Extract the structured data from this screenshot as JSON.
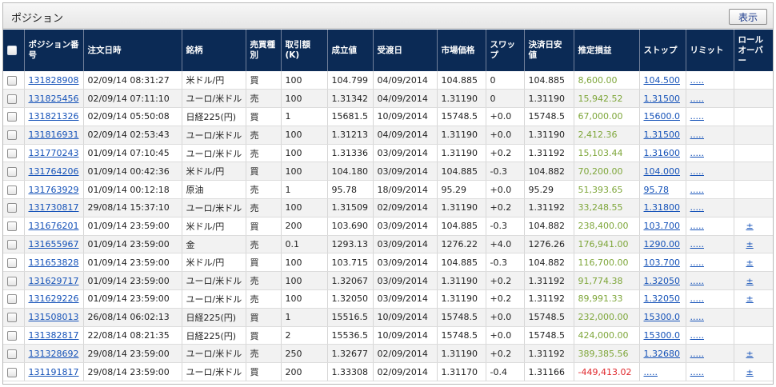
{
  "panel": {
    "title": "ポジション",
    "show_button": "表示"
  },
  "colors": {
    "header_bg": "#0b2a55",
    "profit": "#7ea63a",
    "loss": "#e0272c",
    "link": "#1552b8"
  },
  "columns": [
    "ポジション番号",
    "注文日時",
    "銘柄",
    "売買種別",
    "取引額(K)",
    "成立値",
    "受渡日",
    "市場価格",
    "スワップ",
    "決済日安値",
    "推定損益",
    "ストップ",
    "リミット",
    "ロールオーバー"
  ],
  "rows": [
    [
      "131828908",
      "02/09/14 08:31:27",
      "米ドル/円",
      "買",
      "100",
      "104.799",
      "04/09/2014",
      "104.885",
      "0",
      "104.885",
      "8,600.00",
      "104.500",
      ".....",
      ""
    ],
    [
      "131825456",
      "02/09/14 07:11:10",
      "ユーロ/米ドル",
      "売",
      "100",
      "1.31342",
      "04/09/2014",
      "1.31190",
      "0",
      "1.31190",
      "15,942.52",
      "1.31500",
      ".....",
      ""
    ],
    [
      "131821326",
      "02/09/14 05:50:08",
      "日経225(円)",
      "買",
      "1",
      "15681.5",
      "10/09/2014",
      "15748.5",
      "+0.0",
      "15748.5",
      "67,000.00",
      "15600.0",
      ".....",
      ""
    ],
    [
      "131816931",
      "02/09/14 02:53:43",
      "ユーロ/米ドル",
      "売",
      "100",
      "1.31213",
      "04/09/2014",
      "1.31190",
      "+0.0",
      "1.31190",
      "2,412.36",
      "1.31500",
      ".....",
      ""
    ],
    [
      "131770243",
      "01/09/14 07:10:45",
      "ユーロ/米ドル",
      "売",
      "100",
      "1.31336",
      "03/09/2014",
      "1.31190",
      "+0.2",
      "1.31192",
      "15,103.44",
      "1.31600",
      ".....",
      ""
    ],
    [
      "131764206",
      "01/09/14 00:42:36",
      "米ドル/円",
      "買",
      "100",
      "104.180",
      "03/09/2014",
      "104.885",
      "-0.3",
      "104.882",
      "70,200.00",
      "104.000",
      ".....",
      ""
    ],
    [
      "131763929",
      "01/09/14 00:12:18",
      "原油",
      "売",
      "1",
      "95.78",
      "18/09/2014",
      "95.29",
      "+0.0",
      "95.29",
      "51,393.65",
      "95.78",
      ".....",
      ""
    ],
    [
      "131730817",
      "29/08/14 15:37:10",
      "ユーロ/米ドル",
      "売",
      "100",
      "1.31509",
      "02/09/2014",
      "1.31190",
      "+0.2",
      "1.31192",
      "33,248.55",
      "1.31800",
      ".....",
      ""
    ],
    [
      "131676201",
      "01/09/14 23:59:00",
      "米ドル/円",
      "買",
      "200",
      "103.690",
      "03/09/2014",
      "104.885",
      "-0.3",
      "104.882",
      "238,400.00",
      "103.700",
      ".....",
      "±"
    ],
    [
      "131655967",
      "01/09/14 23:59:00",
      "金",
      "売",
      "0.1",
      "1293.13",
      "03/09/2014",
      "1276.22",
      "+4.0",
      "1276.26",
      "176,941.00",
      "1290.00",
      ".....",
      "±"
    ],
    [
      "131653828",
      "01/09/14 23:59:00",
      "米ドル/円",
      "買",
      "100",
      "103.715",
      "03/09/2014",
      "104.885",
      "-0.3",
      "104.882",
      "116,700.00",
      "103.700",
      ".....",
      "±"
    ],
    [
      "131629717",
      "01/09/14 23:59:00",
      "ユーロ/米ドル",
      "売",
      "100",
      "1.32067",
      "03/09/2014",
      "1.31190",
      "+0.2",
      "1.31192",
      "91,774.38",
      "1.32050",
      ".....",
      "±"
    ],
    [
      "131629226",
      "01/09/14 23:59:00",
      "ユーロ/米ドル",
      "売",
      "100",
      "1.32050",
      "03/09/2014",
      "1.31190",
      "+0.2",
      "1.31192",
      "89,991.33",
      "1.32050",
      ".....",
      "±"
    ],
    [
      "131508013",
      "26/08/14 06:02:13",
      "日経225(円)",
      "買",
      "1",
      "15516.5",
      "10/09/2014",
      "15748.5",
      "+0.0",
      "15748.5",
      "232,000.00",
      "15300.0",
      ".....",
      ""
    ],
    [
      "131382817",
      "22/08/14 08:21:35",
      "日経225(円)",
      "買",
      "2",
      "15536.5",
      "10/09/2014",
      "15748.5",
      "+0.0",
      "15748.5",
      "424,000.00",
      "15300.0",
      ".....",
      ""
    ],
    [
      "131328692",
      "29/08/14 23:59:00",
      "ユーロ/米ドル",
      "売",
      "250",
      "1.32677",
      "02/09/2014",
      "1.31190",
      "+0.2",
      "1.31192",
      "389,385.56",
      "1.32680",
      ".....",
      "±"
    ],
    [
      "131191817",
      "29/08/14 23:59:00",
      "ユーロ/米ドル",
      "買",
      "200",
      "1.33308",
      "02/09/2014",
      "1.31170",
      "-0.4",
      "1.31166",
      "-449,413.02",
      ".....",
      ".....",
      "±"
    ]
  ]
}
